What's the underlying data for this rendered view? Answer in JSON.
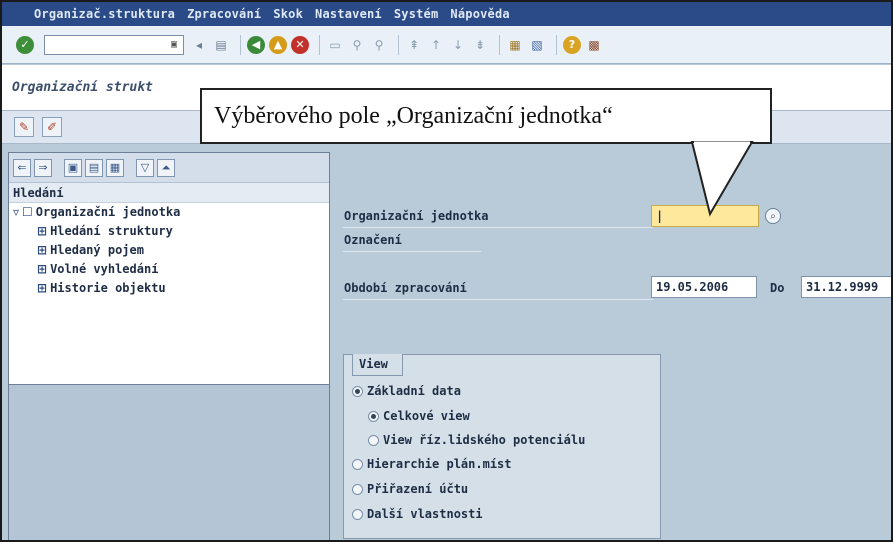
{
  "menu": {
    "items": [
      "Organizač.struktura",
      "Zpracování",
      "Skok",
      "Nastavení",
      "Systém",
      "Nápověda"
    ]
  },
  "toolbar": {
    "command_value": "",
    "icons": [
      "enter-icon",
      "save-icon",
      "back-icon",
      "exit-icon",
      "cancel-icon",
      "print-icon",
      "find-icon",
      "find-next-icon",
      "first-page-icon",
      "prev-page-icon",
      "next-page-icon",
      "last-page-icon",
      "create-session-icon",
      "shortcut-icon",
      "help-icon",
      "layout-icon"
    ]
  },
  "title": "Organizační strukt",
  "app_toolbar": {
    "icons": [
      "change-icon",
      "edit-icon"
    ]
  },
  "left_panel": {
    "header": "Hledání",
    "tree": {
      "root": "Organizační jednotka",
      "children": [
        "Hledání struktury",
        "Hledaný pojem",
        "Volné vyhledání",
        "Historie objektu"
      ]
    }
  },
  "form": {
    "org_unit_label": "Organizační jednotka",
    "org_unit_value": "|",
    "designation_label": "Označení",
    "period_label": "Období zpracování",
    "period_from": "19.05.2006",
    "period_to_label": "Do",
    "period_to": "31.12.9999"
  },
  "view": {
    "title": "View",
    "options": [
      {
        "label": "Základní data",
        "selected": true,
        "indent": 0
      },
      {
        "label": "Celkové view",
        "selected": true,
        "indent": 1
      },
      {
        "label": "View říz.lidského potenciálu",
        "selected": false,
        "indent": 1
      },
      {
        "label": "Hierarchie plán.míst",
        "selected": false,
        "indent": 0
      },
      {
        "label": "Přiřazení účtu",
        "selected": false,
        "indent": 0
      },
      {
        "label": "Další vlastnosti",
        "selected": false,
        "indent": 0
      }
    ]
  },
  "callout": {
    "text": "Výběrového pole „Organizační jednotka“"
  },
  "colors": {
    "menu_bar": "#2b4b88",
    "form_background": "#b9cad8",
    "required_input": "#fde89b"
  }
}
